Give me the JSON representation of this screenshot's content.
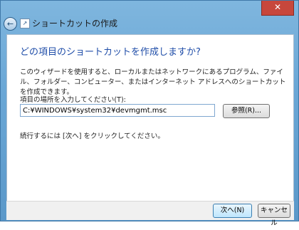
{
  "window": {
    "title": "ショートカットの作成",
    "close_glyph": "✕",
    "back_glyph": "←"
  },
  "wizard": {
    "heading": "どの項目のショートカットを作成しますか?",
    "description": "このウィザードを使用すると、ローカルまたはネットワークにあるプログラム、ファイル、フォルダー、コンピューター、またはインターネット アドレスへのショートカットを作成できます。",
    "location_label": "項目の場所を入力してください(T):",
    "location_value": "C:¥WINDOWS¥system32¥devmgmt.msc",
    "browse_label": "参照(R)...",
    "next_hint": "続行するには [次へ] をクリックしてください。"
  },
  "footer": {
    "next_label": "次へ(N)",
    "cancel_label": "キャンセル"
  }
}
